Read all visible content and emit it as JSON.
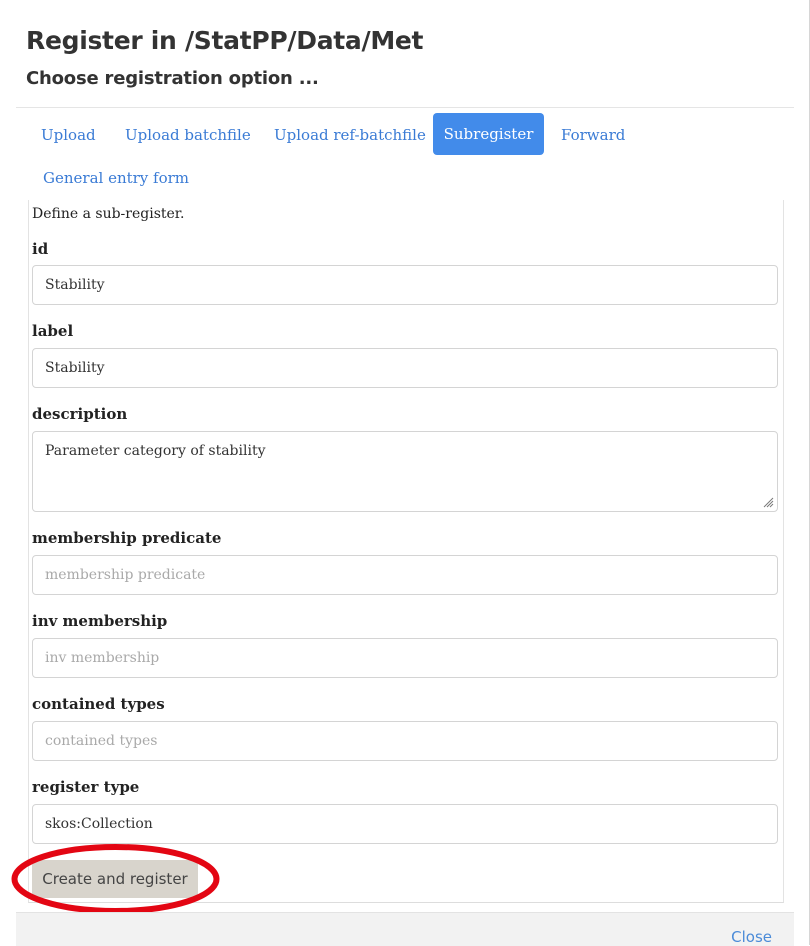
{
  "header": {
    "title": "Register in /StatPP/Data/Met",
    "subtitle": "Choose registration option ..."
  },
  "tabs": [
    {
      "label": "Upload",
      "active": false
    },
    {
      "label": "Upload batchfile",
      "active": false
    },
    {
      "label": "Upload ref-batchfile",
      "active": false
    },
    {
      "label": "Subregister",
      "active": true
    },
    {
      "label": "Forward",
      "active": false
    },
    {
      "label": "General entry form",
      "active": false
    }
  ],
  "form": {
    "intro": "Define a sub-register.",
    "fields": {
      "id": {
        "label": "id",
        "value": "Stability"
      },
      "label": {
        "label": "label",
        "value": "Stability"
      },
      "description": {
        "label": "description",
        "value": "Parameter category of stability"
      },
      "membership_predicate": {
        "label": "membership predicate",
        "placeholder": "membership predicate"
      },
      "inv_membership": {
        "label": "inv membership",
        "placeholder": "inv membership"
      },
      "contained_types": {
        "label": "contained types",
        "placeholder": "contained types"
      },
      "register_type": {
        "label": "register type",
        "value": "skos:Collection"
      }
    },
    "submit_label": "Create and register"
  },
  "footer": {
    "close_label": "Close"
  },
  "colors": {
    "active_tab": "#428bea",
    "link": "#3a7bd5",
    "button_bg": "#d8d4cc",
    "annotation_ring": "#e30613"
  }
}
